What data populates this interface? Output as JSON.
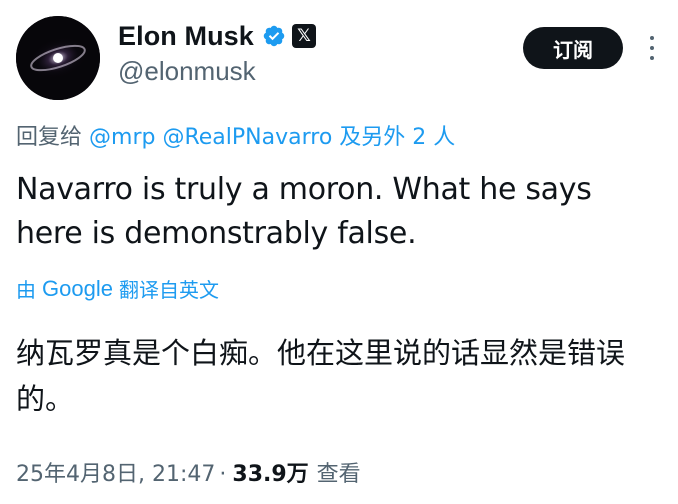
{
  "author": {
    "display_name": "Elon Musk",
    "handle": "@elonmusk",
    "verified_icon": "verified-badge-icon",
    "affiliate_icon": "x-logo-icon",
    "affiliate_glyph": "𝕏"
  },
  "header": {
    "subscribe_label": "订阅",
    "more_icon": "more-vertical-icon"
  },
  "reply": {
    "prefix": "回复给",
    "mentions": [
      "@mrp",
      "@RealPNavarro"
    ],
    "suffix": "及另外 2 人"
  },
  "tweet": {
    "text": "Navarro is truly a moron. What he says here is demonstrably false."
  },
  "translation": {
    "by_label": "由",
    "provider": "Google",
    "action_label": "翻译自英文",
    "text": "纳瓦罗真是个白痴。他在这里说的话显然是错误的。"
  },
  "meta": {
    "timestamp": "25年4月8日, 21:47",
    "separator": "·",
    "views": "33.9万",
    "views_label": "查看"
  },
  "colors": {
    "text": "#0f1419",
    "secondary": "#536471",
    "link": "#1d9bf0",
    "button_bg": "#0f1419"
  }
}
